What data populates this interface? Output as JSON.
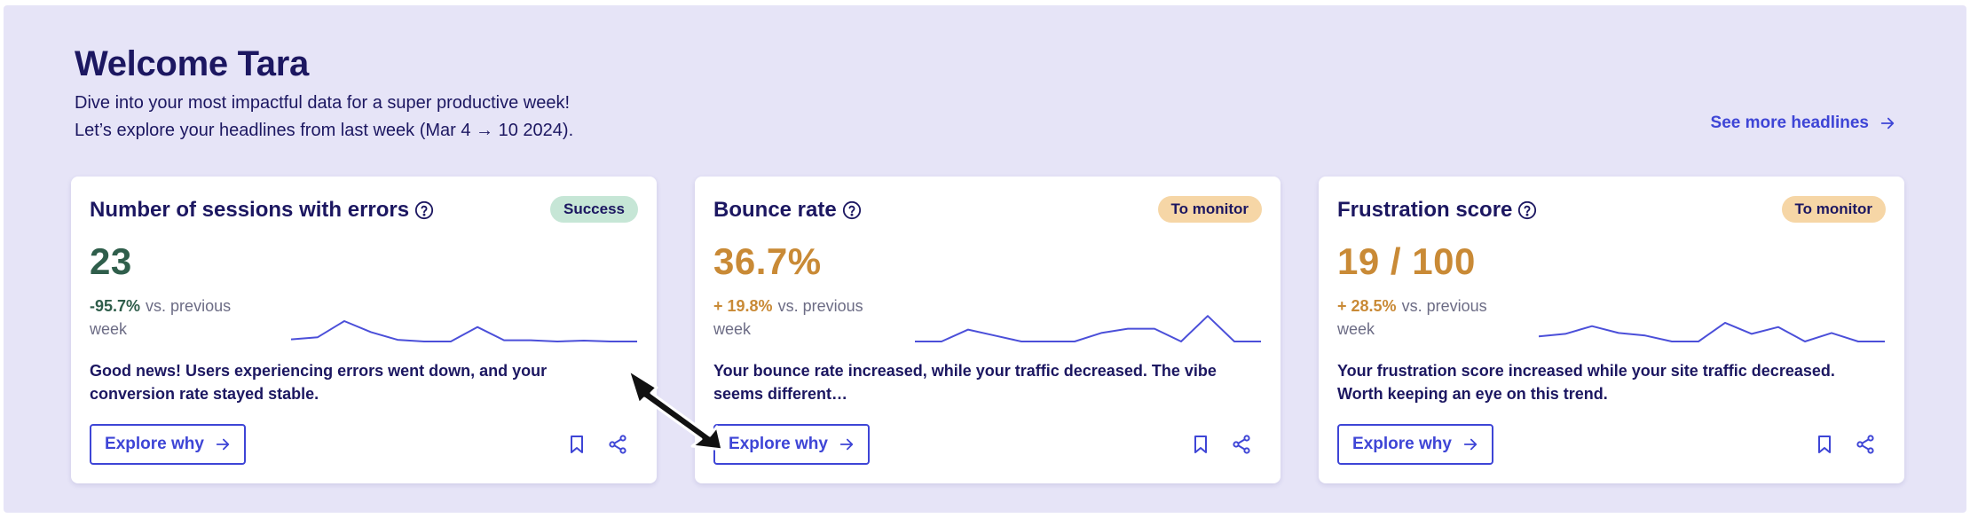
{
  "header": {
    "title": "Welcome Tara",
    "subtitle_line1": "Dive into your most impactful data for a super productive week!",
    "subtitle_line2": "Let’s explore your headlines from last week (Mar 4 → 10 2024).",
    "see_more_label": "See more headlines"
  },
  "colors": {
    "accent": "#3e45d6",
    "text_dark": "#1c1761",
    "success_value": "#2f5e4b",
    "monitor_value": "#c98a36",
    "success_badge_bg": "#c6e6d6",
    "monitor_badge_bg": "#f6d6a6",
    "background": "#e6e4f7"
  },
  "cards": [
    {
      "title": "Number of sessions with errors",
      "badge": "Success",
      "badge_type": "success",
      "value": "23",
      "delta": "-95.7%",
      "delta_suffix": "vs. previous week",
      "description": "Good news! Users experiencing errors went down, and your conversion rate stayed stable.",
      "explore_label": "Explore why",
      "sparkline": [
        0.05,
        0.1,
        0.48,
        0.22,
        0.04,
        0.0,
        0.0,
        0.34,
        0.03,
        0.03,
        0.0,
        0.02,
        0.0,
        0.0
      ]
    },
    {
      "title": "Bounce rate",
      "badge": "To monitor",
      "badge_type": "monitor",
      "value": "36.7%",
      "delta": "+ 19.8%",
      "delta_suffix": "vs. previous week",
      "description": "Your bounce rate increased, while your traffic decreased. The vibe seems different…",
      "explore_label": "Explore why",
      "sparkline": [
        0.0,
        0.0,
        0.28,
        0.14,
        0.0,
        0.0,
        0.0,
        0.2,
        0.3,
        0.3,
        0.0,
        0.6,
        0.0,
        0.0
      ]
    },
    {
      "title": "Frustration score",
      "badge": "To monitor",
      "badge_type": "monitor",
      "value": "19 / 100",
      "delta": "+ 28.5%",
      "delta_suffix": "vs. previous week",
      "description": "Your frustration score increased while your site traffic decreased. Worth keeping an eye on this trend.",
      "explore_label": "Explore why",
      "sparkline": [
        0.12,
        0.18,
        0.36,
        0.2,
        0.14,
        0.0,
        0.0,
        0.44,
        0.18,
        0.34,
        0.0,
        0.2,
        0.0,
        0.0
      ]
    }
  ]
}
